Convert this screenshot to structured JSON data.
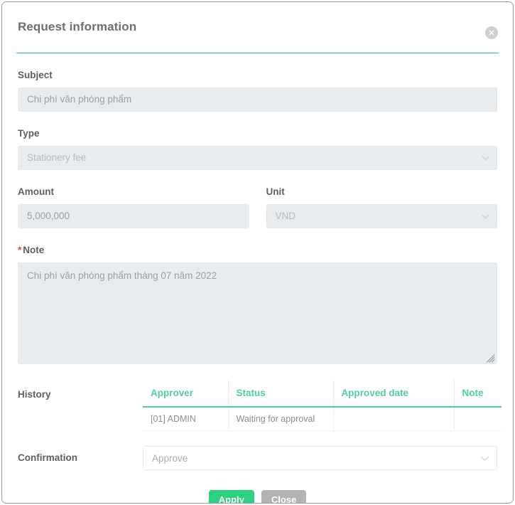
{
  "dialog": {
    "title": "Request information",
    "close_icon": "close-circle-icon"
  },
  "fields": {
    "subject": {
      "label": "Subject",
      "value": "Chi phí văn phòng phẩm"
    },
    "type": {
      "label": "Type",
      "value": "Stationery fee",
      "chevron_icon": "chevron-down-icon"
    },
    "amount": {
      "label": "Amount",
      "value": "5,000,000"
    },
    "unit": {
      "label": "Unit",
      "value": "VND",
      "chevron_icon": "chevron-down-icon"
    },
    "note": {
      "required_marker": "*",
      "label": "Note",
      "value": "Chi phí văn phòng phẩm tháng 07 năm 2022",
      "resize_icon": "resize-grip-icon"
    }
  },
  "history": {
    "label": "History",
    "columns": [
      "Approver",
      "Status",
      "Approved date",
      "Note"
    ],
    "rows": [
      {
        "approver": "[01] ADMIN",
        "status": "Waiting for approval",
        "approved_date": "",
        "note": ""
      }
    ]
  },
  "confirmation": {
    "label": "Confirmation",
    "value": "Approve",
    "chevron_icon": "chevron-down-icon"
  },
  "footer": {
    "apply_label": "Apply",
    "close_label": "Close"
  },
  "colors": {
    "accent_green": "#2ec48e",
    "table_header_green": "#4fd09b",
    "apply_green": "#2bd27f",
    "close_gray": "#b3b3b3",
    "required_red": "#e8453c",
    "disabled_field_bg": "#e8ecef",
    "label_gray": "#5f5f5f"
  }
}
